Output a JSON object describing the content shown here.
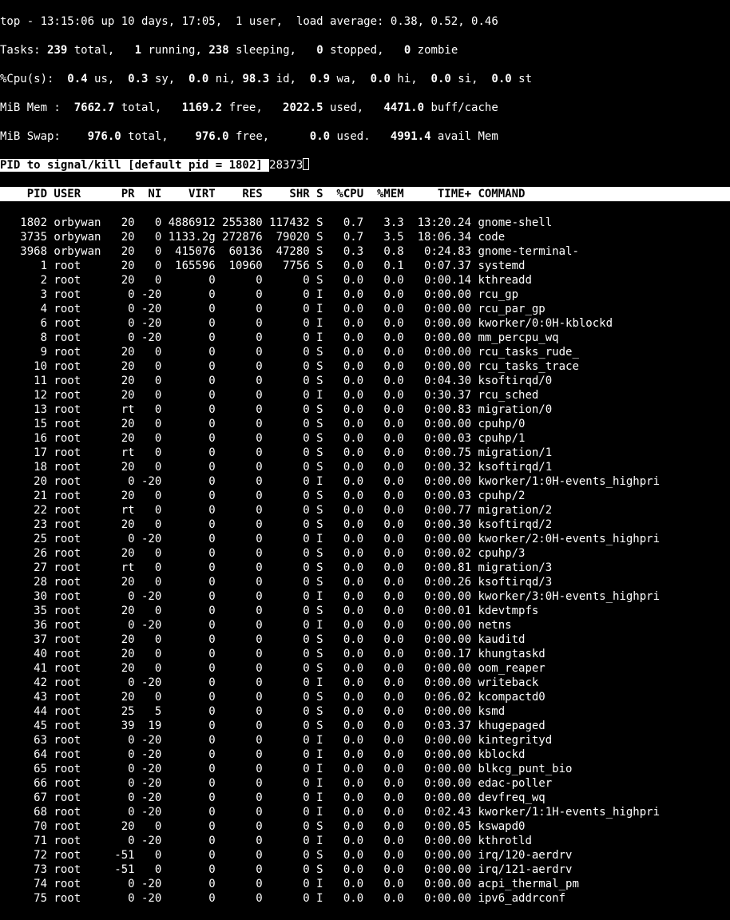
{
  "summary": {
    "line1_prefix": "top - ",
    "time": "13:15:06",
    "uptime": " up 10 days, 17:05,  ",
    "users": "1 user",
    "loadavg_label": ",  load average: ",
    "loadavg": "0.38, 0.52, 0.46",
    "tasks_label": "Tasks: ",
    "tasks_total": "239",
    "tasks_total_suffix": " total,   ",
    "tasks_running": "1",
    "tasks_running_suffix": " running, ",
    "tasks_sleeping": "238",
    "tasks_sleeping_suffix": " sleeping,   ",
    "tasks_stopped": "0",
    "tasks_stopped_suffix": " stopped,   ",
    "tasks_zombie": "0",
    "tasks_zombie_suffix": " zombie",
    "cpu_label": "%Cpu(s):  ",
    "cpu_us": "0.4",
    "cpu_us_suffix": " us,  ",
    "cpu_sy": "0.3",
    "cpu_sy_suffix": " sy,  ",
    "cpu_ni": "0.0",
    "cpu_ni_suffix": " ni, ",
    "cpu_id": "98.3",
    "cpu_id_suffix": " id,  ",
    "cpu_wa": "0.9",
    "cpu_wa_suffix": " wa,  ",
    "cpu_hi": "0.0",
    "cpu_hi_suffix": " hi,  ",
    "cpu_si": "0.0",
    "cpu_si_suffix": " si,  ",
    "cpu_st": "0.0",
    "cpu_st_suffix": " st",
    "mem_label": "MiB Mem :  ",
    "mem_total": "7662.7",
    "mem_total_suffix": " total,   ",
    "mem_free": "1169.2",
    "mem_free_suffix": " free,   ",
    "mem_used": "2022.5",
    "mem_used_suffix": " used,   ",
    "mem_buff": "4471.0",
    "mem_buff_suffix": " buff/cache",
    "swap_label": "MiB Swap:    ",
    "swap_total": "976.0",
    "swap_total_suffix": " total,    ",
    "swap_free": "976.0",
    "swap_free_suffix": " free,      ",
    "swap_used": "0.0",
    "swap_used_suffix": " used.   ",
    "swap_avail": "4991.4",
    "swap_avail_suffix": " avail Mem"
  },
  "prompt": {
    "text": "PID to signal/kill [default pid = 1802] ",
    "input": "28373"
  },
  "header": "    PID USER      PR  NI    VIRT    RES    SHR S  %CPU  %MEM     TIME+ COMMAND           ",
  "cols": [
    "PID",
    "USER",
    "PR",
    "NI",
    "VIRT",
    "RES",
    "SHR",
    "S",
    "%CPU",
    "%MEM",
    "TIME+",
    "COMMAND"
  ],
  "processes": [
    {
      "pid": "1802",
      "user": "orbywan",
      "pr": "20",
      "ni": "0",
      "virt": "4886912",
      "res": "255380",
      "shr": "117432",
      "s": "S",
      "cpu": "0.7",
      "mem": "3.3",
      "time": "13:20.24",
      "cmd": "gnome-shell"
    },
    {
      "pid": "3735",
      "user": "orbywan",
      "pr": "20",
      "ni": "0",
      "virt": "1133.2g",
      "res": "272876",
      "shr": "79020",
      "s": "S",
      "cpu": "0.7",
      "mem": "3.5",
      "time": "18:06.34",
      "cmd": "code"
    },
    {
      "pid": "3968",
      "user": "orbywan",
      "pr": "20",
      "ni": "0",
      "virt": "415076",
      "res": "60136",
      "shr": "47280",
      "s": "S",
      "cpu": "0.3",
      "mem": "0.8",
      "time": "0:24.83",
      "cmd": "gnome-terminal-"
    },
    {
      "pid": "1",
      "user": "root",
      "pr": "20",
      "ni": "0",
      "virt": "165596",
      "res": "10960",
      "shr": "7756",
      "s": "S",
      "cpu": "0.0",
      "mem": "0.1",
      "time": "0:07.37",
      "cmd": "systemd"
    },
    {
      "pid": "2",
      "user": "root",
      "pr": "20",
      "ni": "0",
      "virt": "0",
      "res": "0",
      "shr": "0",
      "s": "S",
      "cpu": "0.0",
      "mem": "0.0",
      "time": "0:00.14",
      "cmd": "kthreadd"
    },
    {
      "pid": "3",
      "user": "root",
      "pr": "0",
      "ni": "-20",
      "virt": "0",
      "res": "0",
      "shr": "0",
      "s": "I",
      "cpu": "0.0",
      "mem": "0.0",
      "time": "0:00.00",
      "cmd": "rcu_gp"
    },
    {
      "pid": "4",
      "user": "root",
      "pr": "0",
      "ni": "-20",
      "virt": "0",
      "res": "0",
      "shr": "0",
      "s": "I",
      "cpu": "0.0",
      "mem": "0.0",
      "time": "0:00.00",
      "cmd": "rcu_par_gp"
    },
    {
      "pid": "6",
      "user": "root",
      "pr": "0",
      "ni": "-20",
      "virt": "0",
      "res": "0",
      "shr": "0",
      "s": "I",
      "cpu": "0.0",
      "mem": "0.0",
      "time": "0:00.00",
      "cmd": "kworker/0:0H-kblockd"
    },
    {
      "pid": "8",
      "user": "root",
      "pr": "0",
      "ni": "-20",
      "virt": "0",
      "res": "0",
      "shr": "0",
      "s": "I",
      "cpu": "0.0",
      "mem": "0.0",
      "time": "0:00.00",
      "cmd": "mm_percpu_wq"
    },
    {
      "pid": "9",
      "user": "root",
      "pr": "20",
      "ni": "0",
      "virt": "0",
      "res": "0",
      "shr": "0",
      "s": "S",
      "cpu": "0.0",
      "mem": "0.0",
      "time": "0:00.00",
      "cmd": "rcu_tasks_rude_"
    },
    {
      "pid": "10",
      "user": "root",
      "pr": "20",
      "ni": "0",
      "virt": "0",
      "res": "0",
      "shr": "0",
      "s": "S",
      "cpu": "0.0",
      "mem": "0.0",
      "time": "0:00.00",
      "cmd": "rcu_tasks_trace"
    },
    {
      "pid": "11",
      "user": "root",
      "pr": "20",
      "ni": "0",
      "virt": "0",
      "res": "0",
      "shr": "0",
      "s": "S",
      "cpu": "0.0",
      "mem": "0.0",
      "time": "0:04.30",
      "cmd": "ksoftirqd/0"
    },
    {
      "pid": "12",
      "user": "root",
      "pr": "20",
      "ni": "0",
      "virt": "0",
      "res": "0",
      "shr": "0",
      "s": "I",
      "cpu": "0.0",
      "mem": "0.0",
      "time": "0:30.37",
      "cmd": "rcu_sched"
    },
    {
      "pid": "13",
      "user": "root",
      "pr": "rt",
      "ni": "0",
      "virt": "0",
      "res": "0",
      "shr": "0",
      "s": "S",
      "cpu": "0.0",
      "mem": "0.0",
      "time": "0:00.83",
      "cmd": "migration/0"
    },
    {
      "pid": "15",
      "user": "root",
      "pr": "20",
      "ni": "0",
      "virt": "0",
      "res": "0",
      "shr": "0",
      "s": "S",
      "cpu": "0.0",
      "mem": "0.0",
      "time": "0:00.00",
      "cmd": "cpuhp/0"
    },
    {
      "pid": "16",
      "user": "root",
      "pr": "20",
      "ni": "0",
      "virt": "0",
      "res": "0",
      "shr": "0",
      "s": "S",
      "cpu": "0.0",
      "mem": "0.0",
      "time": "0:00.03",
      "cmd": "cpuhp/1"
    },
    {
      "pid": "17",
      "user": "root",
      "pr": "rt",
      "ni": "0",
      "virt": "0",
      "res": "0",
      "shr": "0",
      "s": "S",
      "cpu": "0.0",
      "mem": "0.0",
      "time": "0:00.75",
      "cmd": "migration/1"
    },
    {
      "pid": "18",
      "user": "root",
      "pr": "20",
      "ni": "0",
      "virt": "0",
      "res": "0",
      "shr": "0",
      "s": "S",
      "cpu": "0.0",
      "mem": "0.0",
      "time": "0:00.32",
      "cmd": "ksoftirqd/1"
    },
    {
      "pid": "20",
      "user": "root",
      "pr": "0",
      "ni": "-20",
      "virt": "0",
      "res": "0",
      "shr": "0",
      "s": "I",
      "cpu": "0.0",
      "mem": "0.0",
      "time": "0:00.00",
      "cmd": "kworker/1:0H-events_highpri"
    },
    {
      "pid": "21",
      "user": "root",
      "pr": "20",
      "ni": "0",
      "virt": "0",
      "res": "0",
      "shr": "0",
      "s": "S",
      "cpu": "0.0",
      "mem": "0.0",
      "time": "0:00.03",
      "cmd": "cpuhp/2"
    },
    {
      "pid": "22",
      "user": "root",
      "pr": "rt",
      "ni": "0",
      "virt": "0",
      "res": "0",
      "shr": "0",
      "s": "S",
      "cpu": "0.0",
      "mem": "0.0",
      "time": "0:00.77",
      "cmd": "migration/2"
    },
    {
      "pid": "23",
      "user": "root",
      "pr": "20",
      "ni": "0",
      "virt": "0",
      "res": "0",
      "shr": "0",
      "s": "S",
      "cpu": "0.0",
      "mem": "0.0",
      "time": "0:00.30",
      "cmd": "ksoftirqd/2"
    },
    {
      "pid": "25",
      "user": "root",
      "pr": "0",
      "ni": "-20",
      "virt": "0",
      "res": "0",
      "shr": "0",
      "s": "I",
      "cpu": "0.0",
      "mem": "0.0",
      "time": "0:00.00",
      "cmd": "kworker/2:0H-events_highpri"
    },
    {
      "pid": "26",
      "user": "root",
      "pr": "20",
      "ni": "0",
      "virt": "0",
      "res": "0",
      "shr": "0",
      "s": "S",
      "cpu": "0.0",
      "mem": "0.0",
      "time": "0:00.02",
      "cmd": "cpuhp/3"
    },
    {
      "pid": "27",
      "user": "root",
      "pr": "rt",
      "ni": "0",
      "virt": "0",
      "res": "0",
      "shr": "0",
      "s": "S",
      "cpu": "0.0",
      "mem": "0.0",
      "time": "0:00.81",
      "cmd": "migration/3"
    },
    {
      "pid": "28",
      "user": "root",
      "pr": "20",
      "ni": "0",
      "virt": "0",
      "res": "0",
      "shr": "0",
      "s": "S",
      "cpu": "0.0",
      "mem": "0.0",
      "time": "0:00.26",
      "cmd": "ksoftirqd/3"
    },
    {
      "pid": "30",
      "user": "root",
      "pr": "0",
      "ni": "-20",
      "virt": "0",
      "res": "0",
      "shr": "0",
      "s": "I",
      "cpu": "0.0",
      "mem": "0.0",
      "time": "0:00.00",
      "cmd": "kworker/3:0H-events_highpri"
    },
    {
      "pid": "35",
      "user": "root",
      "pr": "20",
      "ni": "0",
      "virt": "0",
      "res": "0",
      "shr": "0",
      "s": "S",
      "cpu": "0.0",
      "mem": "0.0",
      "time": "0:00.01",
      "cmd": "kdevtmpfs"
    },
    {
      "pid": "36",
      "user": "root",
      "pr": "0",
      "ni": "-20",
      "virt": "0",
      "res": "0",
      "shr": "0",
      "s": "I",
      "cpu": "0.0",
      "mem": "0.0",
      "time": "0:00.00",
      "cmd": "netns"
    },
    {
      "pid": "37",
      "user": "root",
      "pr": "20",
      "ni": "0",
      "virt": "0",
      "res": "0",
      "shr": "0",
      "s": "S",
      "cpu": "0.0",
      "mem": "0.0",
      "time": "0:00.00",
      "cmd": "kauditd"
    },
    {
      "pid": "40",
      "user": "root",
      "pr": "20",
      "ni": "0",
      "virt": "0",
      "res": "0",
      "shr": "0",
      "s": "S",
      "cpu": "0.0",
      "mem": "0.0",
      "time": "0:00.17",
      "cmd": "khungtaskd"
    },
    {
      "pid": "41",
      "user": "root",
      "pr": "20",
      "ni": "0",
      "virt": "0",
      "res": "0",
      "shr": "0",
      "s": "S",
      "cpu": "0.0",
      "mem": "0.0",
      "time": "0:00.00",
      "cmd": "oom_reaper"
    },
    {
      "pid": "42",
      "user": "root",
      "pr": "0",
      "ni": "-20",
      "virt": "0",
      "res": "0",
      "shr": "0",
      "s": "I",
      "cpu": "0.0",
      "mem": "0.0",
      "time": "0:00.00",
      "cmd": "writeback"
    },
    {
      "pid": "43",
      "user": "root",
      "pr": "20",
      "ni": "0",
      "virt": "0",
      "res": "0",
      "shr": "0",
      "s": "S",
      "cpu": "0.0",
      "mem": "0.0",
      "time": "0:06.02",
      "cmd": "kcompactd0"
    },
    {
      "pid": "44",
      "user": "root",
      "pr": "25",
      "ni": "5",
      "virt": "0",
      "res": "0",
      "shr": "0",
      "s": "S",
      "cpu": "0.0",
      "mem": "0.0",
      "time": "0:00.00",
      "cmd": "ksmd"
    },
    {
      "pid": "45",
      "user": "root",
      "pr": "39",
      "ni": "19",
      "virt": "0",
      "res": "0",
      "shr": "0",
      "s": "S",
      "cpu": "0.0",
      "mem": "0.0",
      "time": "0:03.37",
      "cmd": "khugepaged"
    },
    {
      "pid": "63",
      "user": "root",
      "pr": "0",
      "ni": "-20",
      "virt": "0",
      "res": "0",
      "shr": "0",
      "s": "I",
      "cpu": "0.0",
      "mem": "0.0",
      "time": "0:00.00",
      "cmd": "kintegrityd"
    },
    {
      "pid": "64",
      "user": "root",
      "pr": "0",
      "ni": "-20",
      "virt": "0",
      "res": "0",
      "shr": "0",
      "s": "I",
      "cpu": "0.0",
      "mem": "0.0",
      "time": "0:00.00",
      "cmd": "kblockd"
    },
    {
      "pid": "65",
      "user": "root",
      "pr": "0",
      "ni": "-20",
      "virt": "0",
      "res": "0",
      "shr": "0",
      "s": "I",
      "cpu": "0.0",
      "mem": "0.0",
      "time": "0:00.00",
      "cmd": "blkcg_punt_bio"
    },
    {
      "pid": "66",
      "user": "root",
      "pr": "0",
      "ni": "-20",
      "virt": "0",
      "res": "0",
      "shr": "0",
      "s": "I",
      "cpu": "0.0",
      "mem": "0.0",
      "time": "0:00.00",
      "cmd": "edac-poller"
    },
    {
      "pid": "67",
      "user": "root",
      "pr": "0",
      "ni": "-20",
      "virt": "0",
      "res": "0",
      "shr": "0",
      "s": "I",
      "cpu": "0.0",
      "mem": "0.0",
      "time": "0:00.00",
      "cmd": "devfreq_wq"
    },
    {
      "pid": "68",
      "user": "root",
      "pr": "0",
      "ni": "-20",
      "virt": "0",
      "res": "0",
      "shr": "0",
      "s": "I",
      "cpu": "0.0",
      "mem": "0.0",
      "time": "0:02.43",
      "cmd": "kworker/1:1H-events_highpri"
    },
    {
      "pid": "70",
      "user": "root",
      "pr": "20",
      "ni": "0",
      "virt": "0",
      "res": "0",
      "shr": "0",
      "s": "S",
      "cpu": "0.0",
      "mem": "0.0",
      "time": "0:00.05",
      "cmd": "kswapd0"
    },
    {
      "pid": "71",
      "user": "root",
      "pr": "0",
      "ni": "-20",
      "virt": "0",
      "res": "0",
      "shr": "0",
      "s": "I",
      "cpu": "0.0",
      "mem": "0.0",
      "time": "0:00.00",
      "cmd": "kthrotld"
    },
    {
      "pid": "72",
      "user": "root",
      "pr": "-51",
      "ni": "0",
      "virt": "0",
      "res": "0",
      "shr": "0",
      "s": "S",
      "cpu": "0.0",
      "mem": "0.0",
      "time": "0:00.00",
      "cmd": "irq/120-aerdrv"
    },
    {
      "pid": "73",
      "user": "root",
      "pr": "-51",
      "ni": "0",
      "virt": "0",
      "res": "0",
      "shr": "0",
      "s": "S",
      "cpu": "0.0",
      "mem": "0.0",
      "time": "0:00.00",
      "cmd": "irq/121-aerdrv"
    },
    {
      "pid": "74",
      "user": "root",
      "pr": "0",
      "ni": "-20",
      "virt": "0",
      "res": "0",
      "shr": "0",
      "s": "I",
      "cpu": "0.0",
      "mem": "0.0",
      "time": "0:00.00",
      "cmd": "acpi_thermal_pm"
    },
    {
      "pid": "75",
      "user": "root",
      "pr": "0",
      "ni": "-20",
      "virt": "0",
      "res": "0",
      "shr": "0",
      "s": "I",
      "cpu": "0.0",
      "mem": "0.0",
      "time": "0:00.00",
      "cmd": "ipv6_addrconf"
    }
  ]
}
